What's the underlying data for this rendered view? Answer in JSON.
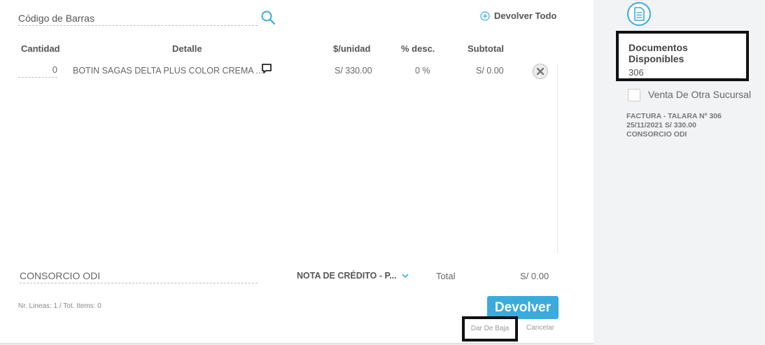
{
  "barcode": {
    "placeholder": "Código de Barras"
  },
  "actions": {
    "devolver_todo": "Devolver Todo"
  },
  "table": {
    "headers": {
      "cantidad": "Cantidad",
      "detalle": "Detalle",
      "unit": "$/unidad",
      "desc": "% desc.",
      "subtotal": "Subtotal"
    },
    "row": {
      "qty": "0",
      "detail": "BOTIN SAGAS DELTA PLUS COLOR CREMA ...",
      "unit": "S/ 330.00",
      "desc": "0 %",
      "subtotal": "S/ 0.00"
    }
  },
  "footer": {
    "client": "CONSORCIO ODI",
    "doc_type": "NOTA DE CRÉDITO - P...",
    "total_label": "Total",
    "total_value": "S/ 0.00",
    "summary": "Nr. Lineas: 1 / Tot. Items: 0",
    "devolver": "Devolver",
    "dar_de_baja": "Dar De Baja",
    "cancelar": "Cancelar"
  },
  "sidebar": {
    "docs_title": "Documentos Disponibles",
    "search_value": "306",
    "other_branch": "Venta De Otra Sucursal",
    "doc_line1": "FACTURA - TALARA Nº 306",
    "doc_line2": "25/11/2021 S/ 330.00",
    "doc_line3": "CONSORCIO ODI"
  },
  "colors": {
    "accent": "#3aabdb",
    "highlight_border": "#111111"
  },
  "icons": [
    "search-icon",
    "plus-circle-icon",
    "comment-icon",
    "remove-circle-icon",
    "chevron-down-icon",
    "document-icon"
  ]
}
